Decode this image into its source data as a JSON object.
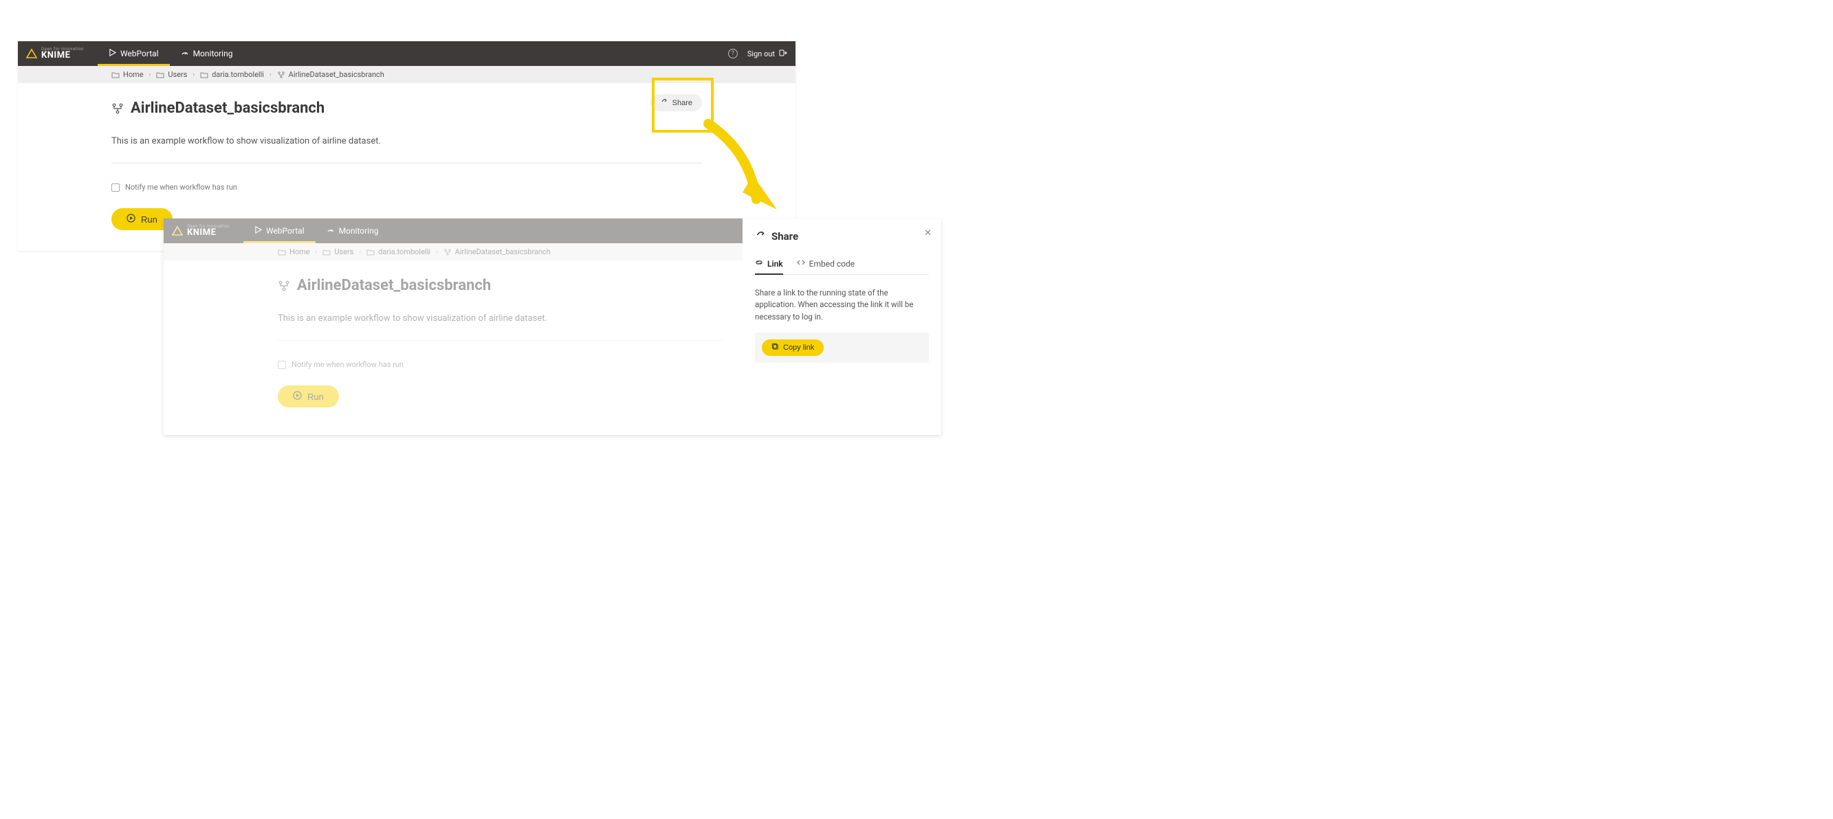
{
  "brand": {
    "name": "KNIME",
    "tagline": "Open for Innovation"
  },
  "nav": {
    "webportal": "WebPortal",
    "monitoring": "Monitoring"
  },
  "header_right": {
    "signout": "Sign out"
  },
  "breadcrumbs": [
    {
      "label": "Home"
    },
    {
      "label": "Users"
    },
    {
      "label": "daria.tombolelli"
    },
    {
      "label": "AirlineDataset_basicsbranch"
    }
  ],
  "page": {
    "title": "AirlineDataset_basicsbranch",
    "description": "This is an example workflow to show visualization of airline dataset.",
    "notify_label": "Notify me when workflow has run",
    "run_label": "Run",
    "share_label": "Share"
  },
  "share_panel": {
    "title": "Share",
    "tab_link": "Link",
    "tab_embed": "Embed code",
    "description": "Share a link to the running state of the application. When accessing the link it will be necessary to log in.",
    "copy_link_label": "Copy link"
  }
}
